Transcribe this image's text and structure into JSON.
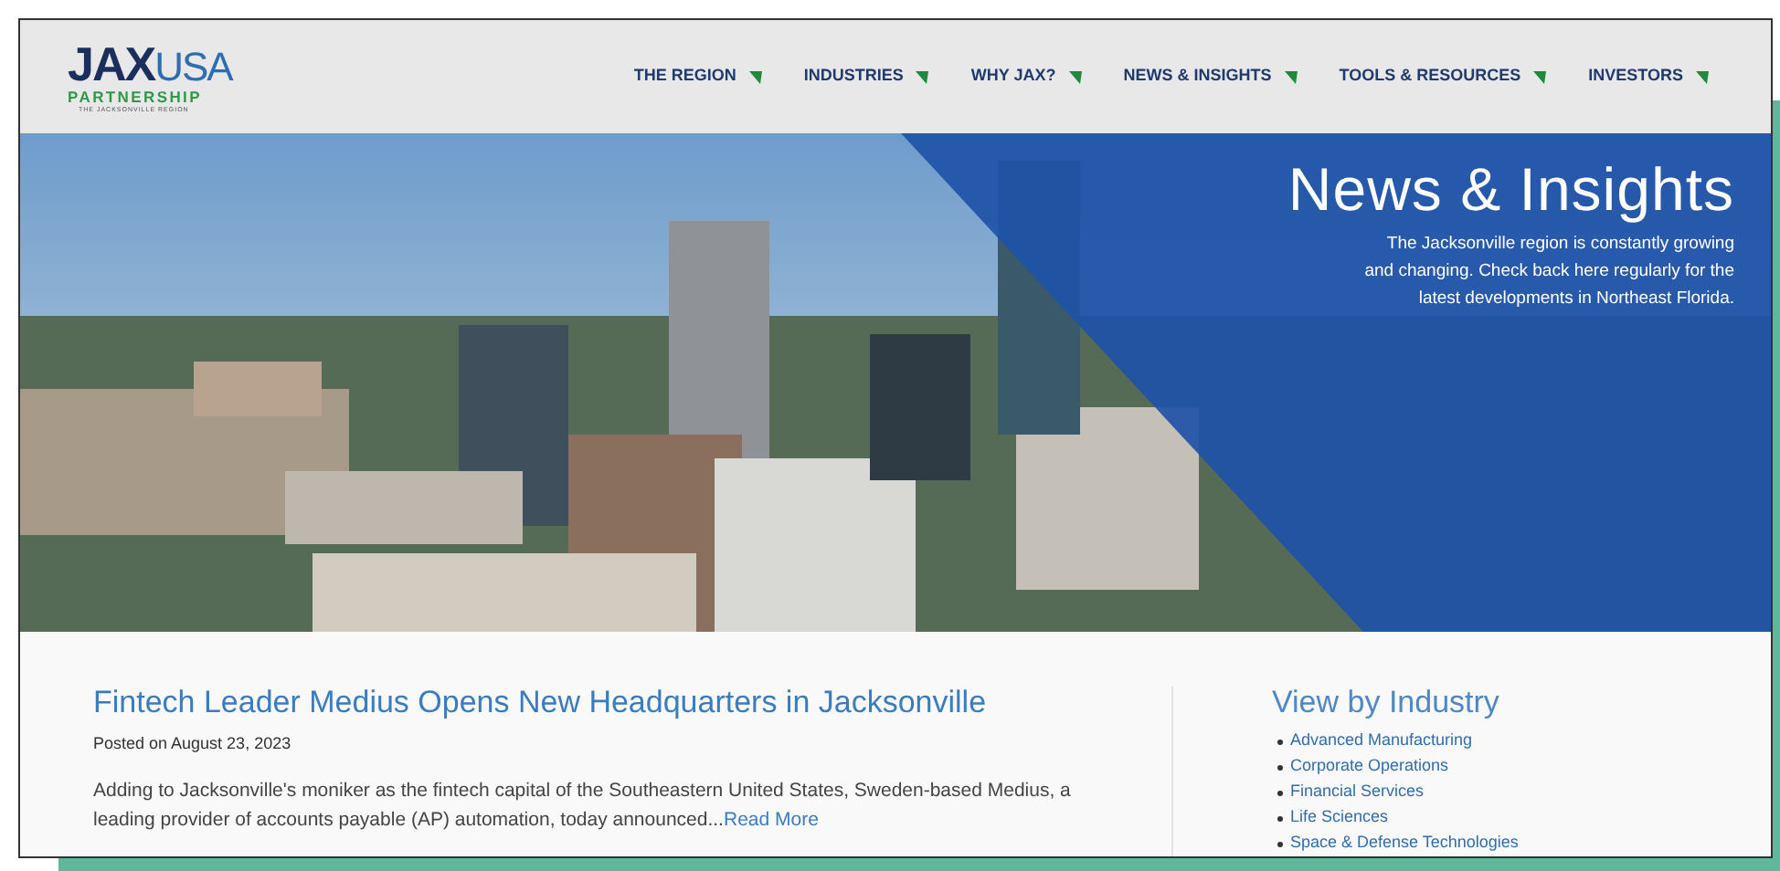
{
  "logo": {
    "brand": "JAX",
    "brand_suffix": "USA",
    "line": "PARTNERSHIP",
    "tagline": "THE JACKSONVILLE REGION"
  },
  "nav": [
    {
      "label": "THE REGION"
    },
    {
      "label": "INDUSTRIES"
    },
    {
      "label": "WHY JAX?"
    },
    {
      "label": "NEWS & INSIGHTS"
    },
    {
      "label": "TOOLS & RESOURCES"
    },
    {
      "label": "INVESTORS"
    }
  ],
  "hero": {
    "title": "News & Insights",
    "lines": [
      "The Jacksonville region is constantly growing",
      "and changing. Check back here regularly for the",
      "latest developments in Northeast Florida."
    ]
  },
  "article": {
    "title": "Fintech Leader Medius Opens New Headquarters in Jacksonville",
    "date": "Posted on August 23, 2023",
    "excerpt": "Adding to Jacksonville's moniker as the fintech capital of the Southeastern United States, Sweden-based Medius, a leading provider of accounts payable (AP) automation, today announced...",
    "read_more": "Read More"
  },
  "sidebar": {
    "title": "View by Industry",
    "items": [
      "Advanced Manufacturing",
      "Corporate Operations",
      "Financial Services",
      "Life Sciences",
      "Space & Defense Technologies"
    ]
  }
}
